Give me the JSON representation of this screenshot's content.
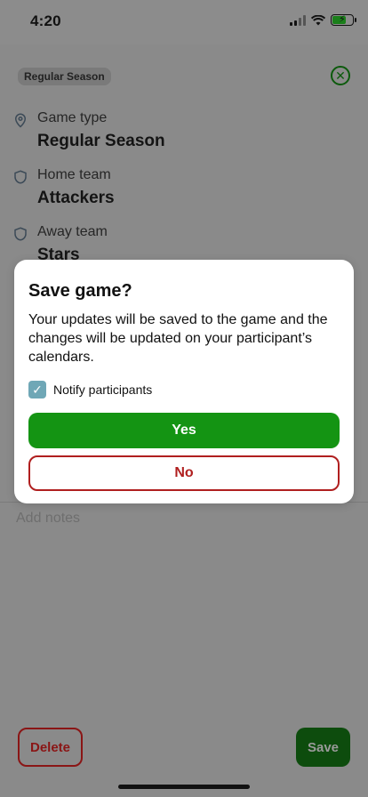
{
  "status_bar": {
    "time": "4:20"
  },
  "sheet": {
    "badge": "Regular Season",
    "close_icon": "circle-x-icon",
    "fields": [
      {
        "icon": "location-pin-icon",
        "label": "Game type",
        "value": "Regular Season"
      },
      {
        "icon": "shield-icon",
        "label": "Home team",
        "value": "Attackers"
      },
      {
        "icon": "shield-icon",
        "label": "Away team",
        "value": "Stars"
      }
    ],
    "notes_placeholder": "Add notes",
    "delete_label": "Delete",
    "save_label": "Save"
  },
  "modal": {
    "title": "Save game?",
    "body": "Your updates will be saved to the game and the changes will be updated on your participant’s calendars.",
    "notify_label": "Notify participants",
    "notify_checked": true,
    "yes_label": "Yes",
    "no_label": "No"
  },
  "colors": {
    "primary_green": "#149413",
    "danger_red": "#b01f1f",
    "checkbox_teal": "#6fa7b6"
  }
}
